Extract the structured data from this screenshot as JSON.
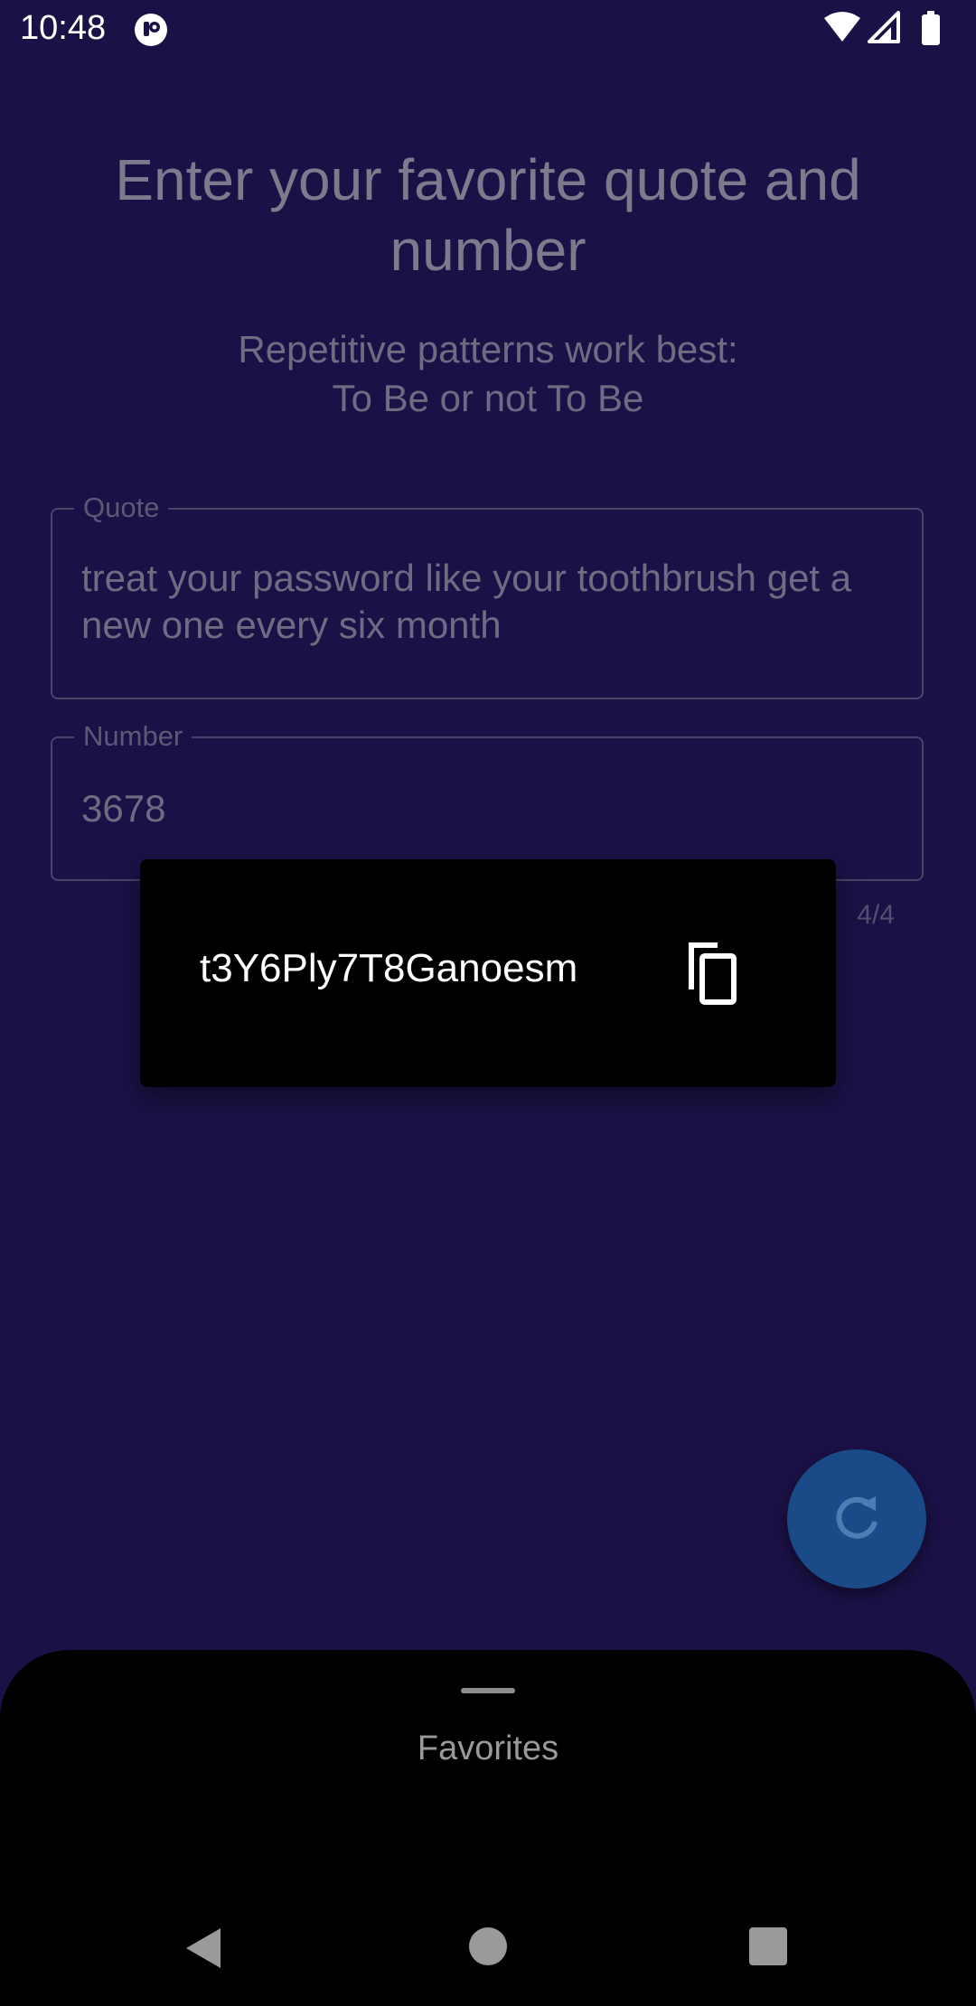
{
  "status_bar": {
    "time": "10:48",
    "icons": [
      "app-notification-icon",
      "wifi-icon",
      "signal-icon",
      "battery-icon"
    ]
  },
  "main": {
    "headline": "Enter your favorite quote and number",
    "subhead_line1": "Repetitive patterns work best:",
    "subhead_line2": "To Be or not To Be",
    "quote_field": {
      "label": "Quote",
      "value": "treat your password like your toothbrush get a new one every six month"
    },
    "number_field": {
      "label": "Number",
      "value": "3678",
      "counter": "4/4"
    }
  },
  "popup": {
    "password": "t3Y6Ply7T8Ganoesm",
    "copy_icon": "copy-icon"
  },
  "fab": {
    "icon": "refresh-icon",
    "color": "#1a4a87"
  },
  "bottom_sheet": {
    "title": "Favorites"
  },
  "nav_bar": {
    "icons": [
      "back-icon",
      "home-icon",
      "recents-icon"
    ]
  },
  "colors": {
    "background": "#1c1147",
    "popup": "#000000",
    "sheet": "#000000"
  }
}
